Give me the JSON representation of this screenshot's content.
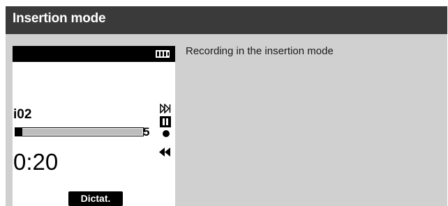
{
  "header": {
    "title": "Insertion mode"
  },
  "description": "Recording in the insertion mode",
  "device": {
    "file_name": "i02",
    "position_number": "5",
    "elapsed_time": "0:20",
    "progress_fraction": 0.06,
    "softkey_label": "Dictat.",
    "icons": [
      "battery-icon",
      "fast-forward-icon",
      "pause-icon",
      "record-icon",
      "rewind-icon"
    ]
  },
  "colors": {
    "header_bg": "#3a3a3a",
    "panel_bg": "#d0d0d0",
    "screen_bg": "#ffffff",
    "status_bar_bg": "#000000"
  }
}
